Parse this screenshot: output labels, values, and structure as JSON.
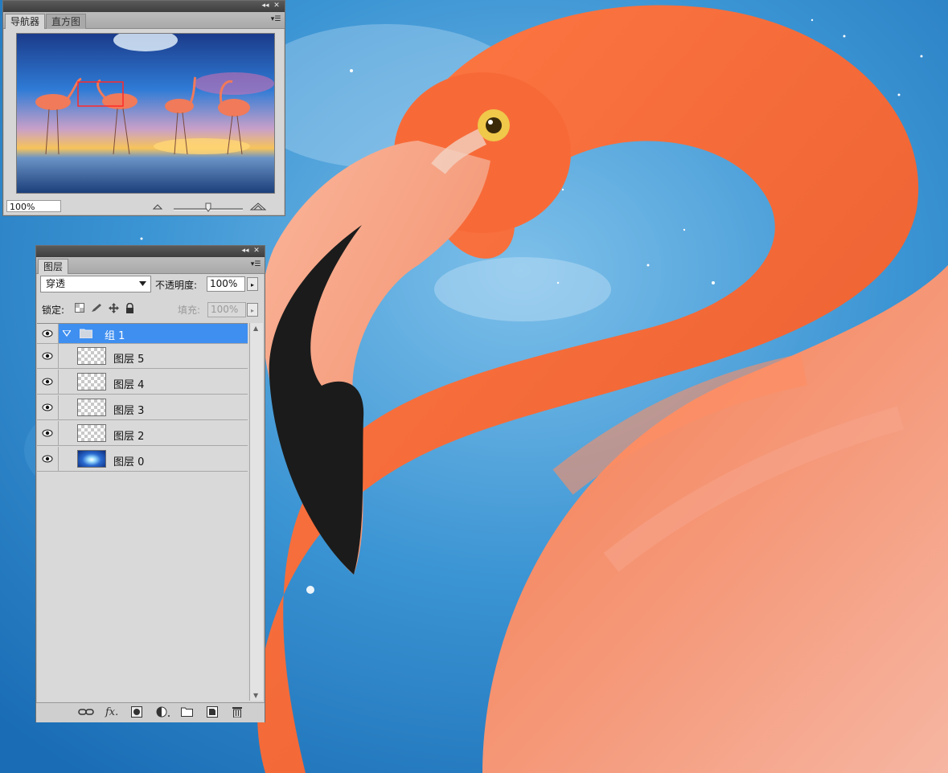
{
  "navigator_panel": {
    "tabs": [
      {
        "label": "导航器",
        "active": true
      },
      {
        "label": "直方图",
        "active": false
      }
    ],
    "zoom_value": "100%",
    "zoom_slider_level_fraction": 0.5
  },
  "layers_panel": {
    "tab_label": "图层",
    "blend_mode": "穿透",
    "opacity_label": "不透明度:",
    "opacity_value": "100%",
    "lock_label": "锁定:",
    "fill_label": "填充:",
    "fill_value": "100%",
    "group": {
      "name": "组 1",
      "expanded": true,
      "selected": true
    },
    "layers": [
      {
        "name": "图层 5",
        "thumb": "transparent"
      },
      {
        "name": "图层 4",
        "thumb": "transparent"
      },
      {
        "name": "图层 3",
        "thumb": "transparent"
      },
      {
        "name": "图层 2",
        "thumb": "transparent"
      },
      {
        "name": "图层 0",
        "thumb": "photo"
      }
    ],
    "bottom_icons": [
      "link-icon",
      "fx-icon",
      "mask-icon",
      "adjustment-icon",
      "new-group-icon",
      "new-layer-icon",
      "trash-icon"
    ]
  },
  "colors": {
    "selection_blue": "#3f8ff0",
    "panel_gray": "#d6d6d6",
    "sky_blue": "#2d86c9",
    "flamingo_orange": "#f36a3c"
  }
}
